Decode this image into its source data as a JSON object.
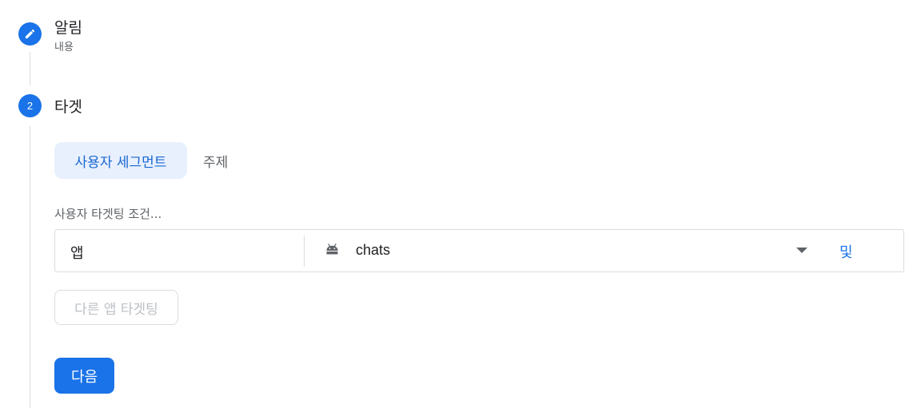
{
  "colors": {
    "accent": "#1a73e8",
    "tab_active_bg": "#e8f0fe",
    "border": "#dadce0"
  },
  "steps": [
    {
      "number": "",
      "icon": "pencil-icon",
      "title": "알림",
      "subtitle": "내용",
      "state": "completed"
    },
    {
      "number": "2",
      "title": "타겟",
      "state": "active"
    }
  ],
  "tabs": [
    {
      "label": "사용자 세그먼트",
      "selected": true
    },
    {
      "label": "주제",
      "selected": false
    }
  ],
  "targeting": {
    "section_label": "사용자 타겟팅 조건...",
    "conditions": [
      {
        "label": "앱",
        "platform_icon": "android-icon",
        "app": "chats",
        "connector": "및"
      }
    ],
    "add_other_app_label": "다른 앱 타겟팅"
  },
  "next_label": "다음"
}
